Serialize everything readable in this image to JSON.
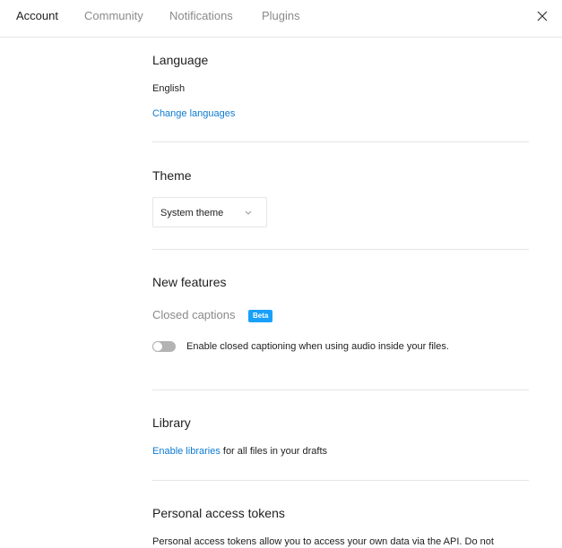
{
  "tabs": [
    {
      "label": "Account",
      "active": true
    },
    {
      "label": "Community",
      "active": false
    },
    {
      "label": "Notifications",
      "active": false
    },
    {
      "label": "Plugins",
      "active": false
    }
  ],
  "close_icon": "close-icon",
  "language": {
    "title": "Language",
    "current": "English",
    "change_link": "Change languages"
  },
  "theme": {
    "title": "Theme",
    "selected": "System theme"
  },
  "new_features": {
    "title": "New features",
    "closed_captions": {
      "label": "Closed captions",
      "badge": "Beta",
      "toggle_on": false,
      "toggle_label": "Enable closed captioning when using audio inside your files."
    }
  },
  "library": {
    "title": "Library",
    "link": "Enable libraries",
    "text": " for all files in your drafts"
  },
  "tokens": {
    "title": "Personal access tokens",
    "description": "Personal access tokens allow you to access your own data via the API. Do not"
  },
  "colors": {
    "link": "#0d7ad1",
    "badge": "#18a0fb"
  }
}
